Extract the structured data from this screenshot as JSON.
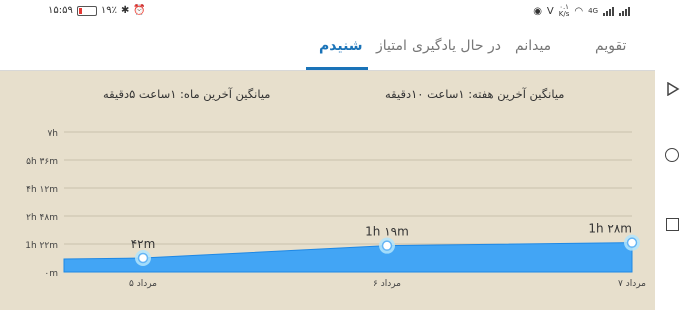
{
  "status_bar": {
    "time": "۱۵:۵۹",
    "battery": "۱۹٪",
    "net_speed": "۰.۱",
    "net_unit": "K/s",
    "network_type": "4G",
    "volte": "V"
  },
  "tabs": [
    {
      "label": "تقویم",
      "active": false
    },
    {
      "label": "میدانم",
      "active": false
    },
    {
      "label": "در حال یادگیری",
      "active": false
    },
    {
      "label": "امتیاز",
      "active": false
    },
    {
      "label": "شنیدم",
      "active": true
    }
  ],
  "summary": {
    "month_avg": "میانگین آخرین ماه: ۱ساعت ۵دقیقه",
    "week_avg": "میانگین آخرین هفته: ۱ساعت ۱۰دقیقه"
  },
  "colors": {
    "panel_bg": "#e7dfcc",
    "area_fill": "#42a5f5",
    "accent": "#1a73b8"
  },
  "chart_data": {
    "type": "area",
    "x": [
      "۵ مرداد",
      "۶ مرداد",
      "۷ مرداد"
    ],
    "values_minutes": [
      42,
      79,
      88
    ],
    "data_labels": [
      "۴۲m",
      "1h ۱۹m",
      "1h ۲۸m"
    ],
    "y_ticks": [
      "۰m",
      "1h ۲۲m",
      "۲h ۴۸m",
      "۴h ۱۲m",
      "۵h ۳۶m",
      "۷h"
    ],
    "ylim_minutes": [
      0,
      420
    ],
    "grid": true
  },
  "icons": {
    "back": "triangle-back-icon",
    "home": "circle-home-icon",
    "recent": "square-recent-icon"
  }
}
